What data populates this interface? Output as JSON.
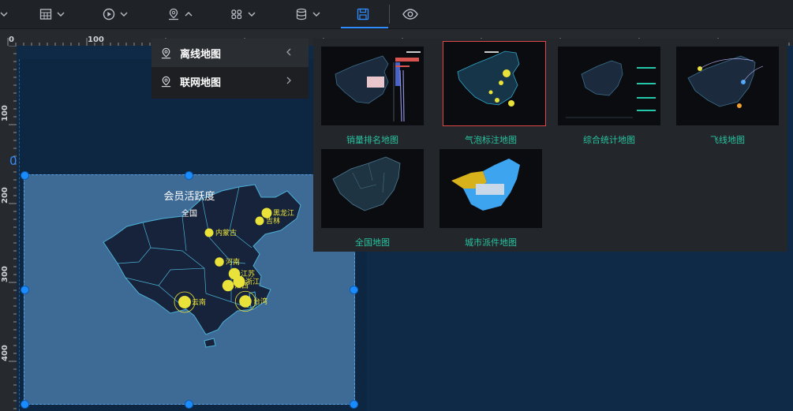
{
  "toolbar": {
    "icons": [
      "table-icon",
      "play-icon",
      "map-pin-icon",
      "grid-icon",
      "database-icon",
      "save-icon",
      "eye-icon"
    ],
    "accent_color": "#2e8cff"
  },
  "ruler": {
    "top_labels": [
      "0",
      "100"
    ],
    "left_labels": [
      "100",
      "200",
      "300",
      "400"
    ]
  },
  "canvas": {
    "zero_label": "0"
  },
  "widget": {
    "title": "会员活跃度",
    "subtitle": "全国",
    "points": [
      {
        "label": "黑龙江",
        "value": 0.7
      },
      {
        "label": "吉林",
        "value": 0.5
      },
      {
        "label": "内蒙古",
        "value": 0.5
      },
      {
        "label": "河南",
        "value": 0.55
      },
      {
        "label": "江苏",
        "value": 0.85
      },
      {
        "label": "浙江",
        "value": 0.9
      },
      {
        "label": "江西",
        "value": 0.85
      },
      {
        "label": "云南",
        "value": 1.0
      },
      {
        "label": "台湾",
        "value": 0.95
      }
    ],
    "point_color": "#e8e23a"
  },
  "menu": {
    "items": [
      {
        "label": "离线地图"
      },
      {
        "label": "联网地图"
      }
    ]
  },
  "thumbnails": {
    "items": [
      {
        "label": "销量排名地图"
      },
      {
        "label": "气泡标注地图"
      },
      {
        "label": "综合统计地图"
      },
      {
        "label": "飞线地图"
      },
      {
        "label": "全国地图"
      },
      {
        "label": "城市派件地图"
      }
    ],
    "selected": "气泡标注地图",
    "label_color": "#29c4a0"
  }
}
